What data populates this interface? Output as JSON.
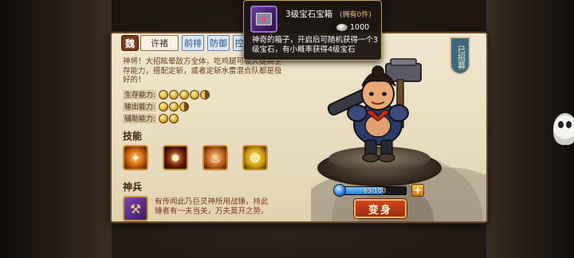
{
  "hero": {
    "faction": "魏",
    "name": "许褚",
    "tags": [
      "前排",
      "防御",
      "控"
    ],
    "description": "神将！大招眩晕敌方全体，吃鸡腿可极大提高生存能力，搭配定斩，或者定斩水雷混合队都是极好的！",
    "stats": [
      {
        "label": "生存能力:",
        "stars": 4.5
      },
      {
        "label": "输出能力:",
        "stars": 2.5
      },
      {
        "label": "辅助能力:",
        "stars": 2
      }
    ],
    "skills_title": "技能",
    "skills": [
      "skill-1",
      "skill-2",
      "skill-3",
      "skill-4"
    ],
    "weapon_title": "神兵",
    "weapon_desc": "有传闻此乃巨灵神所用战锤，持此锤者有一夫当关，万夫莫开之势。",
    "recruited": "已招募",
    "exp": {
      "text": "63/100",
      "fraction": 0.63
    },
    "plus_label": "+",
    "transform_label": "变身"
  },
  "tooltip": {
    "title": "3级宝石宝箱",
    "owned": "(拥有0件)",
    "price": "1000",
    "description": "神奇的箱子，开启后可随机获得一个3级宝石，有小概率获得4级宝石"
  },
  "colors": {
    "parchment": "#f1e6cf",
    "accent_red": "#c03a18",
    "gold": "#f0c24a",
    "tag_blue": "#1d4f8a"
  }
}
